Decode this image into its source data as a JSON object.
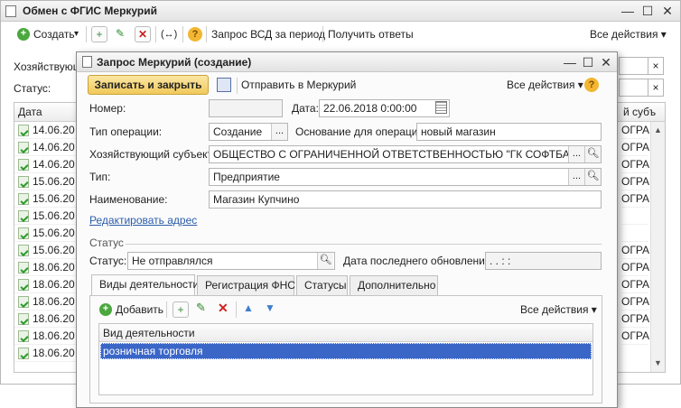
{
  "back": {
    "title": "Обмен с ФГИС Меркурий",
    "toolbar": {
      "create": "Создать",
      "create_arrow": "▾",
      "add_icon": "+",
      "edit_icon": "✎",
      "delete_icon": "✕",
      "link_icon": "(↔)",
      "help": "?",
      "request_vsd": "Запрос ВСД за период",
      "get_answers": "Получить ответы",
      "all_actions": "Все действия ▾"
    },
    "filter_subject_label": "Хозяйствующ",
    "filter_status_label": "Статус:",
    "grid": {
      "col_date": "Дата",
      "col_subject": "й субъ",
      "dates": [
        "14.06.20",
        "14.06.20",
        "14.06.20",
        "15.06.20",
        "15.06.20",
        "15.06.20",
        "15.06.20",
        "15.06.20",
        "18.06.20",
        "18.06.20",
        "18.06.20",
        "18.06.20",
        "18.06.20",
        "18.06.20"
      ],
      "right_cells": [
        "ОГРА",
        "ОГРА",
        "ОГРА",
        "ОГРА",
        "ОГРА",
        "",
        "",
        "ОГРА",
        "ОГРА",
        "ОГРА",
        "ОГРА",
        "ОГРА",
        "ОГРА"
      ]
    }
  },
  "front": {
    "title": "Запрос Меркурий (создание)",
    "btn_save_close": "Записать и закрыть",
    "btn_send": "Отправить в Меркурий",
    "all_actions": "Все действия ▾",
    "help": "?",
    "number_label": "Номер:",
    "number_value": "",
    "date_label": "Дата:",
    "date_value": "22.06.2018  0:00:00",
    "optype_label": "Тип операции:",
    "optype_value": "Создание",
    "basis_label": "Основание для операции:",
    "basis_value": "новый магазин",
    "subject_label": "Хозяйствующий субъект:",
    "subject_value": "ОБЩЕСТВО С ОГРАНИЧЕННОЙ ОТВЕТСТВЕННОСТЬЮ \"ГК СОФТБАЛАНС\"",
    "type_label": "Тип:",
    "type_value": "Предприятие",
    "name_label": "Наименование:",
    "name_value": "Магазин Купчино",
    "edit_address": "Редактировать адрес",
    "status_section": "Статус",
    "status_label": "Статус:",
    "status_value": "Не отправлялся",
    "last_update_label": "Дата последнего обновления:",
    "last_update_value": "  .  .       :  :",
    "tabs": [
      "Виды деятельности",
      "Регистрация ФНС",
      "Статусы",
      "Дополнительно"
    ],
    "tab_toolbar": {
      "add": "Добавить",
      "all_actions": "Все действия ▾"
    },
    "table": {
      "header": "Вид деятельности",
      "rows": [
        "розничная торговля"
      ]
    }
  },
  "colors": {
    "accent_yellow": "#f5d77a",
    "selection": "#3a66c8",
    "link": "#2a5caa"
  }
}
